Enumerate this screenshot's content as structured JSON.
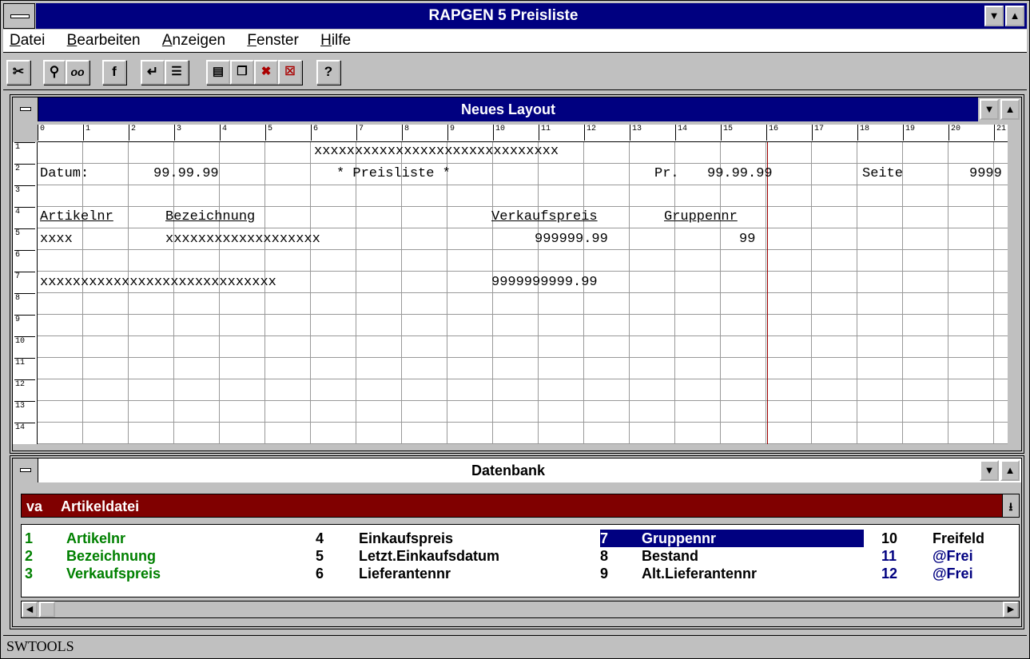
{
  "app": {
    "title": "RAPGEN 5 Preisliste",
    "status": "SWTOOLS"
  },
  "menu": [
    {
      "label": "Datei"
    },
    {
      "label": "Bearbeiten"
    },
    {
      "label": "Anzeigen"
    },
    {
      "label": "Fenster"
    },
    {
      "label": "Hilfe"
    }
  ],
  "toolbar": {
    "cut_icon": "scissors-icon",
    "find_icon": "magnifier-icon",
    "find_glasses_icon": "glasses-icon",
    "function_label": "f",
    "enter_icon": "enter-icon",
    "list_icon": "list-icon",
    "help_label": "?"
  },
  "layout_window": {
    "title": "Neues Layout",
    "ruler_cols": [
      "0",
      "1",
      "2",
      "3",
      "4",
      "5",
      "6",
      "7",
      "8",
      "9",
      "10",
      "11",
      "12",
      "13",
      "14",
      "15",
      "16",
      "17",
      "18",
      "19",
      "20",
      "21"
    ],
    "ruler_rows": [
      "1",
      "2",
      "3",
      "4",
      "5",
      "6",
      "7",
      "8",
      "9",
      "10",
      "11",
      "12",
      "13",
      "14"
    ],
    "lines": {
      "r1_title_mask": "xxxxxxxxxxxxxxxxxxxxxxxxxxxxxx",
      "r2_datum_label": "Datum:",
      "r2_datum_value": "99.99.99",
      "r2_title": "* Preisliste *",
      "r2_pr_label": "Pr.",
      "r2_pr_value": "99.99.99",
      "r2_seite_label": "Seite",
      "r2_seite_value": "9999",
      "r4_h1": "Artikelnr",
      "r4_h2": "Bezeichnung",
      "r4_h3": "Verkaufspreis",
      "r4_h4": "Gruppennr",
      "r5_c1": "xxxx",
      "r5_c2": "xxxxxxxxxxxxxxxxxxx",
      "r5_c3": "999999.99",
      "r5_c4": "99",
      "r7_c1": "xxxxxxxxxxxxxxxxxxxxxxxxxxxxx",
      "r7_c2": "9999999999.99"
    }
  },
  "db_window": {
    "title": "Datenbank",
    "file_prefix": "va",
    "file_name": "Artikeldatei",
    "fields": [
      {
        "num": "1",
        "name": "Artikelnr",
        "color": "#008000"
      },
      {
        "num": "2",
        "name": "Bezeichnung",
        "color": "#008000"
      },
      {
        "num": "3",
        "name": "Verkaufspreis",
        "color": "#008000"
      },
      {
        "num": "4",
        "name": "Einkaufspreis",
        "color": "#000000"
      },
      {
        "num": "5",
        "name": "Letzt.Einkaufsdatum",
        "color": "#000000"
      },
      {
        "num": "6",
        "name": "Lieferantennr",
        "color": "#000000"
      },
      {
        "num": "7",
        "name": "Gruppennr",
        "color": "#ffffff",
        "selected": true
      },
      {
        "num": "8",
        "name": "Bestand",
        "color": "#000000"
      },
      {
        "num": "9",
        "name": "Alt.Lieferantennr",
        "color": "#000000"
      },
      {
        "num": "10",
        "name": "Freifeld",
        "color": "#000000"
      },
      {
        "num": "11",
        "name": "@Frei",
        "color": "#000080"
      },
      {
        "num": "12",
        "name": "@Frei",
        "color": "#000080"
      }
    ]
  },
  "colors": {
    "titlebar": "#000080",
    "selection": "#000080",
    "db_file_bar": "#800000",
    "face": "#c0c0c0"
  }
}
